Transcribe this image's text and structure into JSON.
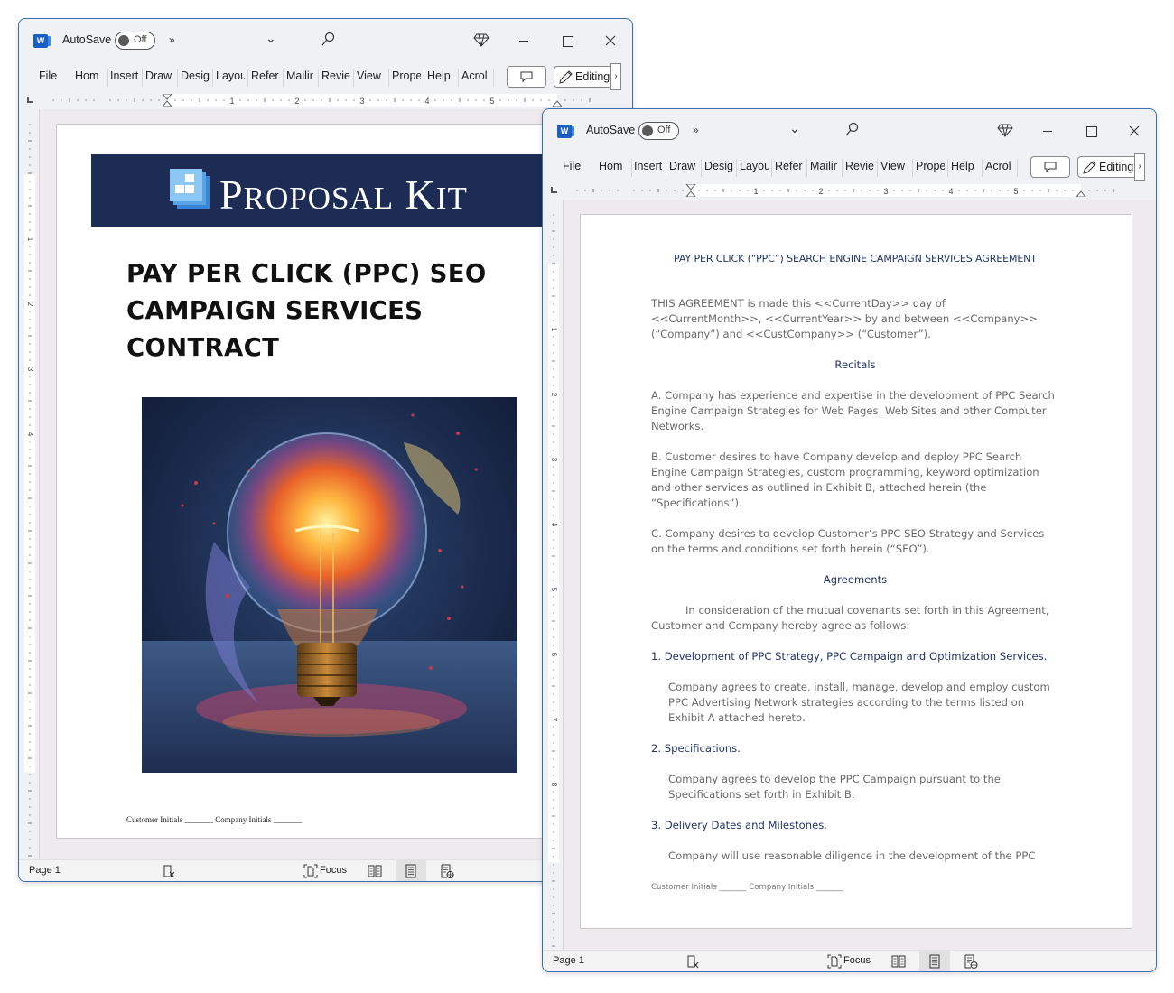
{
  "app": {
    "autosave_label": "AutoSave",
    "autosave_state": "Off",
    "more_commands": "»",
    "editing_label": "Editing",
    "status_page": "Page 1",
    "focus_label": "Focus",
    "ribbon_tabs": [
      "File",
      "Hom",
      "Insert",
      "Draw",
      "Desig",
      "Layou",
      "Refer",
      "Mailir",
      "Revie",
      "View",
      "Prope",
      "Help",
      "Acrol"
    ],
    "ruler_numbers": [
      "1",
      "2",
      "3",
      "4",
      "5"
    ],
    "vertical_ruler_numbers": [
      "1",
      "2",
      "3",
      "4",
      "5",
      "6",
      "7",
      "8"
    ],
    "accent_color": "#1c2c55"
  },
  "window1": {
    "brand": {
      "word_p": "P",
      "word_roposal": "ROPOSAL",
      "word_k": "K",
      "word_it": "IT"
    },
    "cover_title_lines": [
      "PAY PER CLICK (PPC) SEO",
      "CAMPAIGN SERVICES",
      "CONTRACT"
    ],
    "image_alt": "Glowing light bulb with colorful paint splash",
    "footer": "Customer Initials  _______ Company Initials _______"
  },
  "window2": {
    "title": "PAY PER CLICK (“PPC”) SEARCH ENGINE CAMPAIGN SERVICES AGREEMENT",
    "intro": "THIS AGREEMENT is made this <<CurrentDay>> day of <<CurrentMonth>>, <<CurrentYear>> by and between <<Company>> (“Company”) and <<CustCompany>> (“Customer”).",
    "recitals_heading": "Recitals",
    "recitals": [
      "A. Company has experience and expertise in the development of PPC Search Engine Campaign Strategies for Web Pages, Web Sites and other Computer Networks.",
      "B. Customer desires to have Company develop and deploy PPC Search Engine Campaign Strategies, custom programming, keyword optimization and other services as outlined in Exhibit B, attached herein (the “Specifications”).",
      "C. Company desires to develop Customer’s PPC SEO Strategy and Services on the terms and conditions set forth herein (“SEO”)."
    ],
    "agreements_heading": "Agreements",
    "agreements_intro": "In consideration of the mutual covenants set forth in this Agreement, Customer and Company hereby agree as follows:",
    "sections": [
      {
        "heading": "1. Development of PPC Strategy, PPC Campaign and Optimization Services.",
        "body": "Company agrees to create, install, manage, develop and employ custom PPC Advertising Network strategies according to the terms listed on Exhibit A attached hereto."
      },
      {
        "heading": "2. Specifications.",
        "body": "Company agrees to develop the PPC Campaign pursuant to the Specifications set forth in Exhibit B."
      },
      {
        "heading": "3. Delivery Dates and Milestones.",
        "body": "Company will use reasonable diligence in the development of the PPC"
      }
    ],
    "footer": "Customer Initials  _______ Company Initials _______"
  }
}
